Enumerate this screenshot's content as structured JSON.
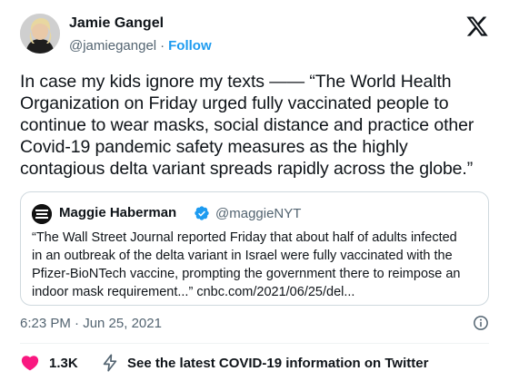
{
  "author": {
    "name": "Jamie Gangel",
    "handle": "@jamiegangel",
    "separator": "·",
    "follow_label": "Follow"
  },
  "tweet": {
    "lines": [
      "In case my kids ignore my texts ——  “The World Health",
      "Organization on Friday urged fully vaccinated people to",
      "continue to wear masks, social distance and practice other",
      "Covid-19 pandemic safety measures as the highly",
      "contagious delta variant spreads rapidly across the globe.”"
    ]
  },
  "quote": {
    "name": "Maggie Haberman",
    "handle": "@maggieNYT",
    "lines": [
      "“The Wall Street Journal reported Friday that about half of adults infected",
      "in an outbreak of the delta variant in Israel were fully vaccinated with the",
      "Pfizer-BioNTech vaccine, prompting the government there to reimpose an",
      "indoor mask requirement...” cnbc.com/2021/06/25/del..."
    ]
  },
  "timestamp": "6:23 PM · Jun 25, 2021",
  "actions": {
    "like_count": "1.3K",
    "covid_info_label": "See the latest COVID-19 information on Twitter"
  },
  "colors": {
    "accent": "#1d9bf0",
    "like": "#f91880",
    "text": "#0f1419",
    "secondary": "#536471",
    "border": "#cfd9de"
  },
  "icons": {
    "brand": "x-logo-icon",
    "verified": "verified-badge-icon",
    "info": "info-icon",
    "like": "heart-icon",
    "covid": "lightning-bolt-icon"
  }
}
